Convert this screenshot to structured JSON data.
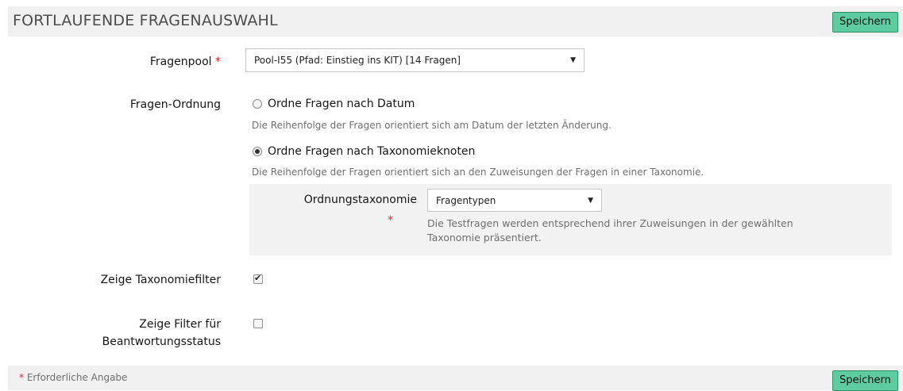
{
  "header": {
    "title": "FORTLAUFENDE FRAGENAUSWAHL",
    "save_label": "Speichern"
  },
  "form": {
    "question_pool": {
      "label": "Fragenpool",
      "required_mark": "*",
      "selected": "Pool-I55 (Pfad: Einstieg ins KIT) [14 Fragen]"
    },
    "question_order": {
      "label": "Fragen-Ordnung",
      "options": [
        {
          "label": "Ordne Fragen nach Datum",
          "description": "Die Reihenfolge der Fragen orientiert sich am Datum der letzten Änderung.",
          "checked": false
        },
        {
          "label": "Ordne Fragen nach Taxonomieknoten",
          "description": "Die Reihenfolge der Fragen orientiert sich an den Zuweisungen der Fragen in einer Taxonomie.",
          "checked": true
        }
      ],
      "taxonomy": {
        "label": "Ordnungstaxonomie",
        "required_mark": "*",
        "selected": "Fragentypen",
        "description": "Die Testfragen werden entsprechend ihrer Zuweisungen in der gewählten Taxonomie präsentiert."
      }
    },
    "show_taxonomy_filter": {
      "label": "Zeige Taxonomiefilter",
      "checked": true
    },
    "show_answer_status_filter": {
      "label": "Zeige Filter für Beantwortungsstatus",
      "checked": false
    }
  },
  "footer": {
    "required_mark": "*",
    "required_note": "Erforderliche Angabe",
    "save_label": "Speichern"
  },
  "colors": {
    "save_button": "#5fcba0",
    "required": "#e02a2a"
  }
}
